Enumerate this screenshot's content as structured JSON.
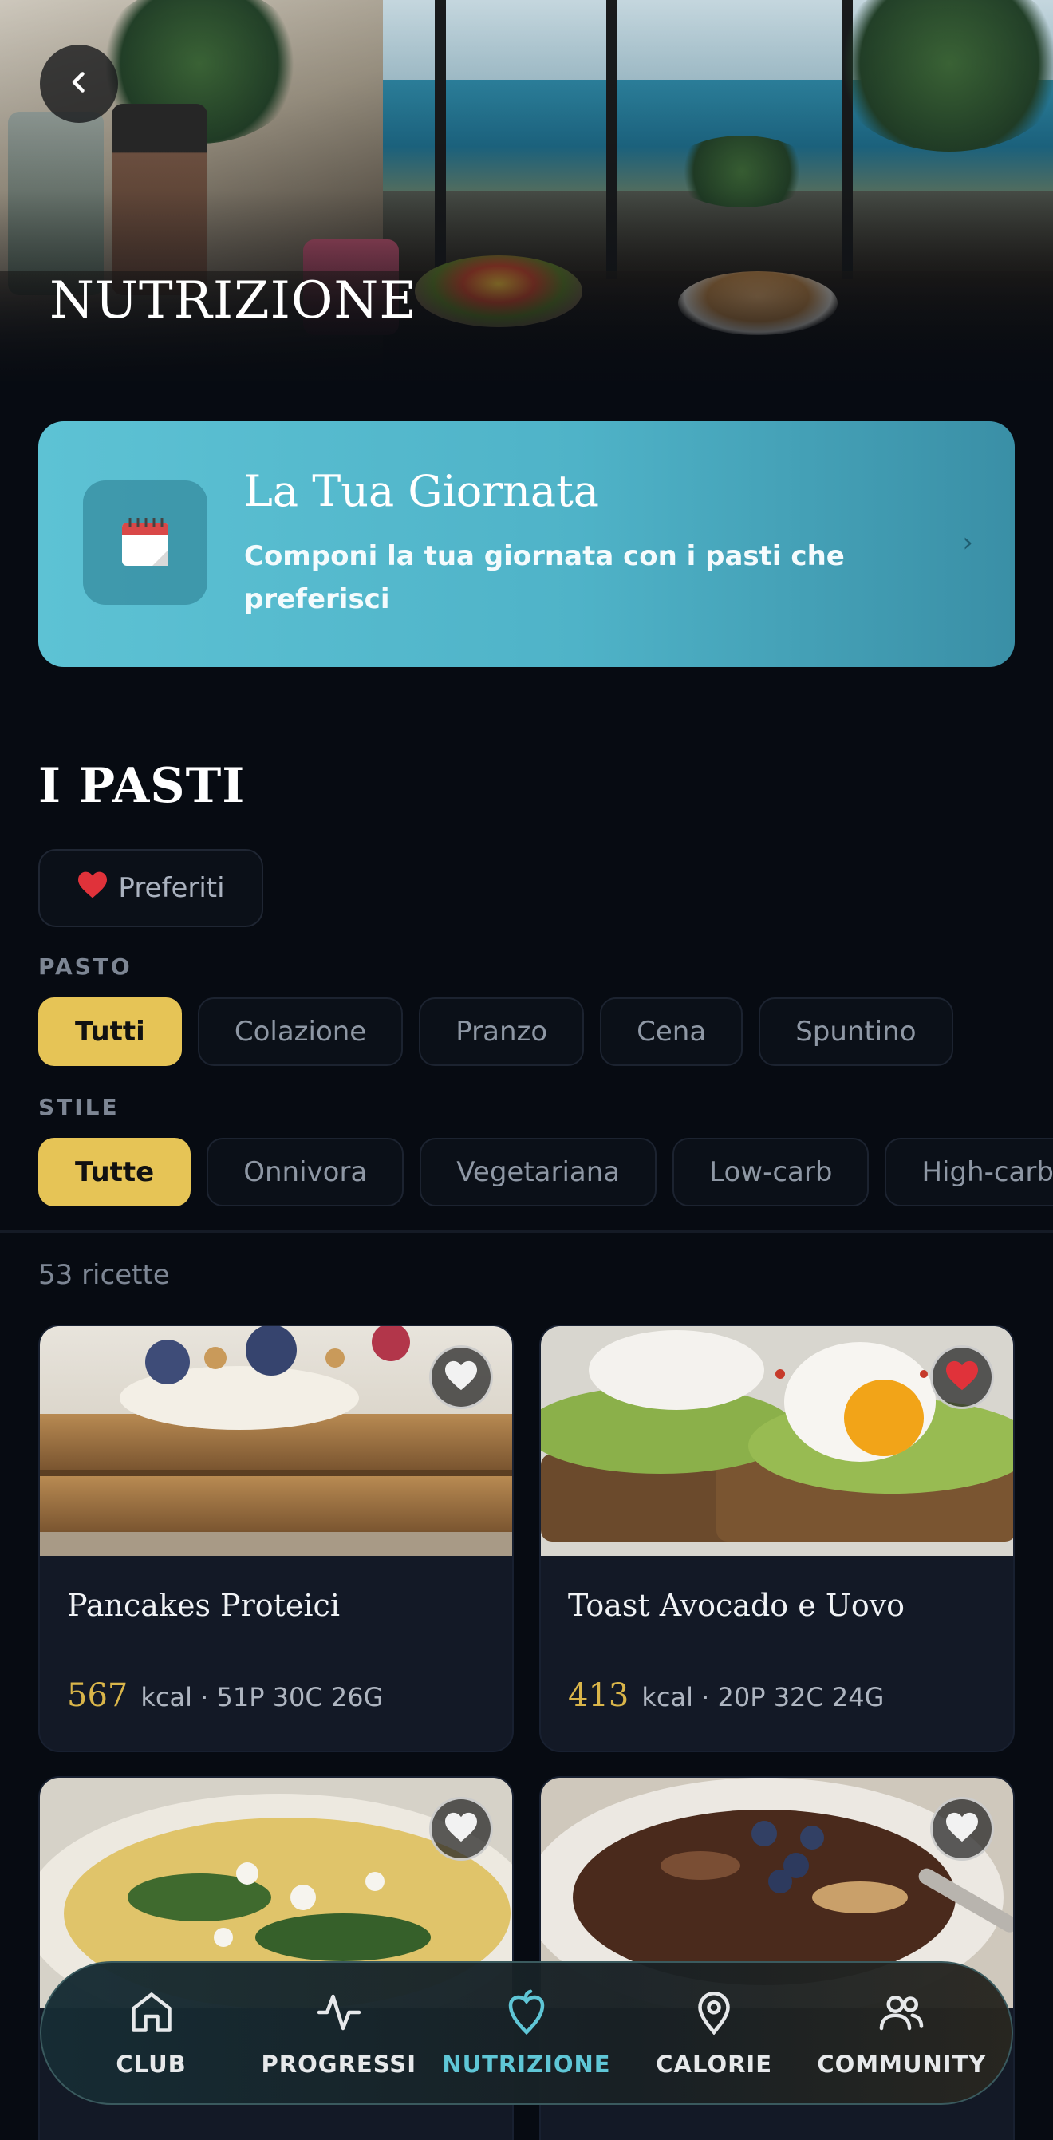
{
  "header": {
    "title": "NUTRIZIONE",
    "back_icon": "chevron-left-icon"
  },
  "day_card": {
    "icon": "calendar-icon",
    "title": "La Tua Giornata",
    "subtitle": "Componi la tua giornata con i pasti che preferisci",
    "chevron": "›"
  },
  "meals": {
    "title": "I PASTI",
    "favorites_chip": {
      "icon": "heart-icon",
      "label": "Preferiti"
    },
    "pasto_label": "PASTO",
    "pasto_chips": [
      "Tutti",
      "Colazione",
      "Pranzo",
      "Cena",
      "Spuntino"
    ],
    "pasto_selected": "Tutti",
    "stile_label": "STILE",
    "stile_chips": [
      "Tutte",
      "Onnivora",
      "Vegetariana",
      "Low-carb",
      "High-carb"
    ],
    "stile_selected": "Tutte",
    "count": "53 ricette"
  },
  "recipes": [
    {
      "name": "Pancakes Proteici",
      "kcal": "567",
      "macros": "kcal · 51P 30C 26G",
      "favorite": false
    },
    {
      "name": "Toast Avocado e Uovo",
      "kcal": "413",
      "macros": "kcal · 20P 32C 24G",
      "favorite": true
    },
    {
      "name": "",
      "kcal": "",
      "macros": "",
      "favorite": false
    },
    {
      "name": "",
      "kcal": "",
      "macros": "",
      "favorite": false
    }
  ],
  "nav": {
    "items": [
      {
        "label": "CLUB",
        "icon": "home-icon"
      },
      {
        "label": "PROGRESSI",
        "icon": "activity-icon"
      },
      {
        "label": "NUTRIZIONE",
        "icon": "nutrition-icon"
      },
      {
        "label": "CALORIE",
        "icon": "location-pin-icon"
      },
      {
        "label": "COMMUNITY",
        "icon": "users-icon"
      }
    ],
    "active": "NUTRIZIONE"
  },
  "colors": {
    "accent_yellow": "#e6c456",
    "accent_teal": "#5fc6d6",
    "background": "#070b12",
    "card": "#131926"
  }
}
